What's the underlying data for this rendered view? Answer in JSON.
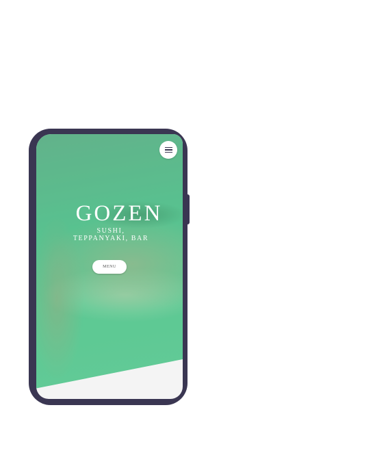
{
  "hero": {
    "title": "GOZEN",
    "subtitle_line1": "SUSHI,",
    "subtitle_line2": "TEPPANYAKI, BAR",
    "menu_button_label": "MENU"
  },
  "icons": {
    "menu_toggle": "hamburger-icon"
  },
  "colors": {
    "device_frame": "#3a3652",
    "hero_overlay": "#5cc191",
    "button_bg": "#ffffff"
  }
}
